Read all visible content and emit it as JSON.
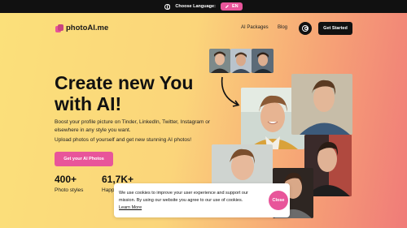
{
  "topbar": {
    "language_label": "Choose Language:",
    "language_value": "EN"
  },
  "header": {
    "brand": "photoAI.me",
    "nav": [
      "AI Packages",
      "Blog"
    ],
    "cta_label": "Get Started"
  },
  "hero": {
    "title_line1": "Create new You",
    "title_line2": "with AI!",
    "subtitle": "Boost your profile picture on Tinder, LinkedIn, Twitter, Instagram or elsewhere in any style you want.",
    "subtitle2": "Upload photos of yourself and get new stunning AI photos!",
    "cta_label": "Get your AI Photos"
  },
  "stats": [
    {
      "value": "400+",
      "label": "Photo styles"
    },
    {
      "value": "61,7K+",
      "label": "Happ"
    }
  ],
  "cookie": {
    "text": "We use cookies to improve your user experience and support our mission. By using our website you agree to our use of cookies.",
    "link": "Learn More",
    "close": "Close"
  },
  "colors": {
    "accent": "#e8559a",
    "dark": "#111111"
  }
}
